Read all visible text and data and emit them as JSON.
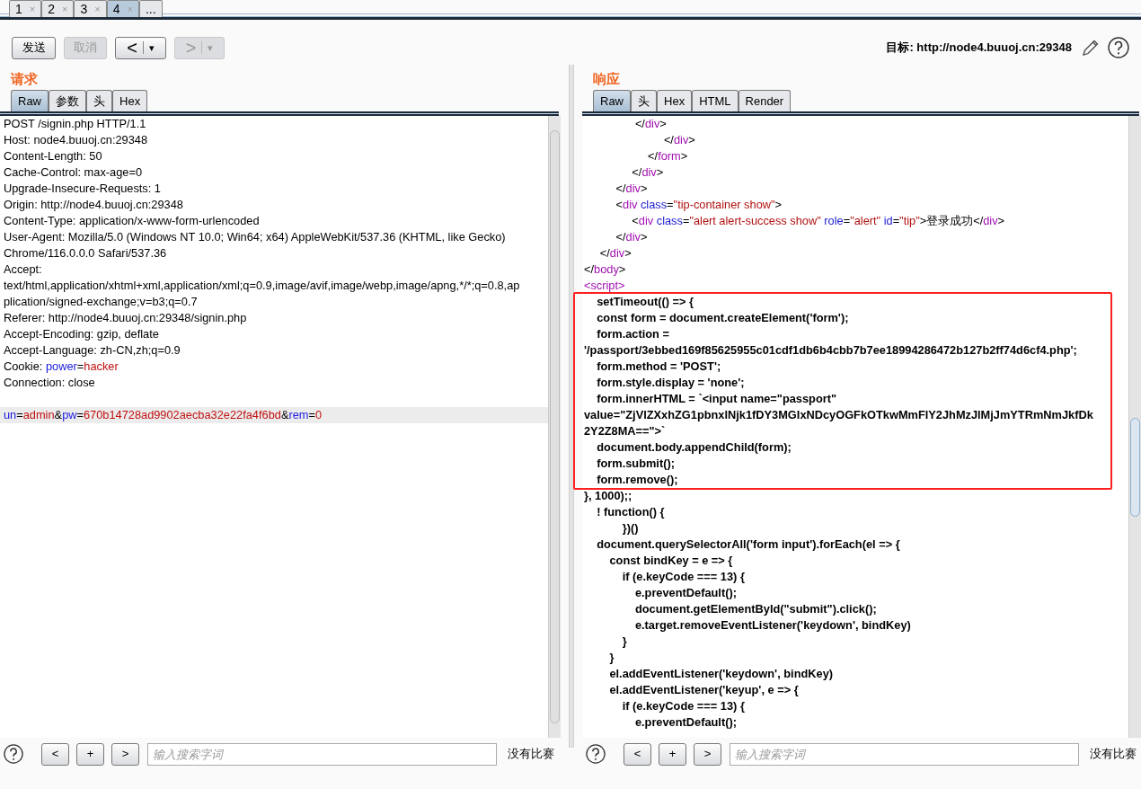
{
  "top_tabs": [
    {
      "label": "1",
      "close": "×",
      "selected": false
    },
    {
      "label": "2",
      "close": "×",
      "selected": false
    },
    {
      "label": "3",
      "close": "×",
      "selected": false
    },
    {
      "label": "4",
      "close": "×",
      "selected": true
    },
    {
      "label": "...",
      "selected": false
    }
  ],
  "toolbar": {
    "buttons": [
      {
        "label": "发送",
        "disabled": false
      },
      {
        "label": "取消",
        "disabled": true
      },
      {
        "label": "<",
        "caret": "▾",
        "disabled": false
      },
      {
        "label": ">",
        "caret": "▾",
        "disabled": true
      }
    ],
    "target": "目标: http://node4.buuoj.cn:29348"
  },
  "panes": [
    {
      "title": "请求",
      "tabs": [
        {
          "label": "Raw",
          "selected": true
        },
        {
          "label": "参数",
          "selected": false
        },
        {
          "label": "头",
          "selected": false
        },
        {
          "label": "Hex",
          "selected": false
        }
      ],
      "lines": [
        {
          "s": [
            {
              "text": "POST /signin.php HTTP/1.1",
              "kind": "text"
            }
          ],
          "highlighted": false
        },
        {
          "s": [
            {
              "text": "Host: node4.buuoj.cn:29348",
              "kind": "text"
            }
          ],
          "highlighted": false
        },
        {
          "s": [
            {
              "text": "Content-Length: 50",
              "kind": "text"
            }
          ],
          "highlighted": false
        },
        {
          "s": [
            {
              "text": "Cache-Control: max-age=0",
              "kind": "text"
            }
          ],
          "highlighted": false
        },
        {
          "s": [
            {
              "text": "Upgrade-Insecure-Requests: 1",
              "kind": "text"
            }
          ],
          "highlighted": false
        },
        {
          "s": [
            {
              "text": "Origin: http://node4.buuoj.cn:29348",
              "kind": "text"
            }
          ],
          "highlighted": false
        },
        {
          "s": [
            {
              "text": "Content-Type: application/x-www-form-urlencoded",
              "kind": "text"
            }
          ],
          "highlighted": false
        },
        {
          "s": [
            {
              "text": "User-Agent: Mozilla/5.0 (Windows NT 10.0; Win64; x64) AppleWebKit/537.36 (KHTML, like Gecko)",
              "kind": "text"
            }
          ],
          "highlighted": false
        },
        {
          "s": [
            {
              "text": "Chrome/116.0.0.0 Safari/537.36",
              "kind": "text"
            }
          ],
          "highlighted": false
        },
        {
          "s": [
            {
              "text": "Accept:",
              "kind": "text"
            }
          ],
          "highlighted": false
        },
        {
          "s": [
            {
              "text": "text/html,application/xhtml+xml,application/xml;q=0.9,image/avif,image/webp,image/apng,*/*;q=0.8,ap",
              "kind": "text"
            }
          ],
          "highlighted": false
        },
        {
          "s": [
            {
              "text": "plication/signed-exchange;v=b3;q=0.7",
              "kind": "text"
            }
          ],
          "highlighted": false
        },
        {
          "s": [
            {
              "text": "Referer: http://node4.buuoj.cn:29348/signin.php",
              "kind": "text"
            }
          ],
          "highlighted": false
        },
        {
          "s": [
            {
              "text": "Accept-Encoding: gzip, deflate",
              "kind": "text"
            }
          ],
          "highlighted": false
        },
        {
          "s": [
            {
              "text": "Accept-Language: zh-CN,zh;q=0.9",
              "kind": "text"
            }
          ],
          "highlighted": false
        },
        {
          "s": [
            {
              "text": "Cookie: ",
              "kind": "text"
            },
            {
              "text": "power",
              "kind": "param"
            },
            {
              "text": "=",
              "kind": "text"
            },
            {
              "text": "hacker",
              "kind": "param_value"
            }
          ],
          "highlighted": false
        },
        {
          "s": [
            {
              "text": "Connection: close",
              "kind": "text"
            }
          ],
          "highlighted": false
        },
        {
          "highlighted": false
        },
        {
          "s": [
            {
              "text": "un",
              "kind": "param"
            },
            {
              "text": "=",
              "kind": "text"
            },
            {
              "text": "admin",
              "kind": "param_value"
            },
            {
              "text": "&",
              "kind": "text"
            },
            {
              "text": "pw",
              "kind": "param"
            },
            {
              "text": "=",
              "kind": "text"
            },
            {
              "text": "670b14728ad9902aecba32e22fa4f6bd",
              "kind": "param_value"
            },
            {
              "text": "&",
              "kind": "text"
            },
            {
              "text": "rem",
              "kind": "param"
            },
            {
              "text": "=",
              "kind": "text"
            },
            {
              "text": "0",
              "kind": "param_value"
            }
          ],
          "highlighted": true
        }
      ],
      "search": {
        "buttons": [
          "<",
          "+",
          ">"
        ],
        "placeholder": "输入搜索字词",
        "matches": "没有比赛"
      }
    },
    {
      "title": "响应",
      "tabs": [
        {
          "label": "Raw",
          "selected": true
        },
        {
          "label": "头",
          "selected": false
        },
        {
          "label": "Hex",
          "selected": false
        },
        {
          "label": "HTML",
          "selected": false
        },
        {
          "label": "Render",
          "selected": false
        }
      ],
      "lines": [
        {
          "s": [
            {
              "text": "                </",
              "kind": "text"
            },
            {
              "text": "div",
              "kind": "tag"
            },
            {
              "text": ">",
              "kind": "text"
            }
          ],
          "boxed": false
        },
        {
          "s": [
            {
              "text": "                         </",
              "kind": "text"
            },
            {
              "text": "div",
              "kind": "tag"
            },
            {
              "text": ">",
              "kind": "text"
            }
          ],
          "boxed": false
        },
        {
          "s": [
            {
              "text": "                    </",
              "kind": "text"
            },
            {
              "text": "form",
              "kind": "tag"
            },
            {
              "text": ">",
              "kind": "text"
            }
          ],
          "boxed": false
        },
        {
          "s": [
            {
              "text": "               </",
              "kind": "text"
            },
            {
              "text": "div",
              "kind": "tag"
            },
            {
              "text": ">",
              "kind": "text"
            }
          ],
          "boxed": false
        },
        {
          "s": [
            {
              "text": "          </",
              "kind": "text"
            },
            {
              "text": "div",
              "kind": "tag"
            },
            {
              "text": ">",
              "kind": "text"
            }
          ],
          "boxed": false
        },
        {
          "s": [
            {
              "text": "          <",
              "kind": "text"
            },
            {
              "text": "div",
              "kind": "tag"
            },
            {
              "text": " class",
              "kind": "attr"
            },
            {
              "text": "=",
              "kind": "text"
            },
            {
              "text": "\"tip-container show\"",
              "kind": "value"
            },
            {
              "text": ">",
              "kind": "text"
            }
          ],
          "boxed": false
        },
        {
          "s": [
            {
              "text": "               <",
              "kind": "text"
            },
            {
              "text": "div",
              "kind": "tag"
            },
            {
              "text": " class",
              "kind": "attr"
            },
            {
              "text": "=",
              "kind": "text"
            },
            {
              "text": "\"alert alert-success show\"",
              "kind": "value"
            },
            {
              "text": " role",
              "kind": "attr"
            },
            {
              "text": "=",
              "kind": "text"
            },
            {
              "text": "\"alert\"",
              "kind": "value"
            },
            {
              "text": " id",
              "kind": "attr"
            },
            {
              "text": "=",
              "kind": "text"
            },
            {
              "text": "\"tip\"",
              "kind": "value"
            },
            {
              "text": ">登录成功</",
              "kind": "text"
            },
            {
              "text": "div",
              "kind": "tag"
            },
            {
              "text": ">",
              "kind": "text"
            }
          ],
          "boxed": false
        },
        {
          "s": [
            {
              "text": "          </",
              "kind": "text"
            },
            {
              "text": "div",
              "kind": "tag"
            },
            {
              "text": ">",
              "kind": "text"
            }
          ],
          "boxed": false
        },
        {
          "s": [
            {
              "text": "     </",
              "kind": "text"
            },
            {
              "text": "div",
              "kind": "tag"
            },
            {
              "text": ">",
              "kind": "text"
            }
          ],
          "boxed": false
        },
        {
          "s": [
            {
              "text": "</",
              "kind": "text"
            },
            {
              "text": "body",
              "kind": "tag"
            },
            {
              "text": ">",
              "kind": "text"
            }
          ],
          "boxed": false
        },
        {
          "s": [
            {
              "text": "<script>",
              "kind": "tag"
            }
          ],
          "boxed": false
        },
        {
          "s": [
            {
              "text": "    setTimeout(() => {",
              "kind": "script"
            }
          ],
          "boxed": true
        },
        {
          "s": [
            {
              "text": "    const form = document.createElement('form');",
              "kind": "script"
            }
          ],
          "boxed": true
        },
        {
          "s": [
            {
              "text": "    form.action =",
              "kind": "script"
            }
          ],
          "boxed": true
        },
        {
          "s": [
            {
              "text": "'/passport/3ebbed169f85625955c01cdf1db6b4cbb7b7ee18994286472b127b2ff74d6cf4.php';",
              "kind": "script"
            }
          ],
          "boxed": true
        },
        {
          "s": [
            {
              "text": "    form.method = 'POST';",
              "kind": "script"
            }
          ],
          "boxed": true
        },
        {
          "s": [
            {
              "text": "    form.style.display = 'none';",
              "kind": "script"
            }
          ],
          "boxed": true
        },
        {
          "s": [
            {
              "text": "    form.innerHTML = `<input name=\"passport\"",
              "kind": "script"
            }
          ],
          "boxed": true
        },
        {
          "s": [
            {
              "text": "value=\"ZjVlZXxhZG1pbnxlNjk1fDY3MGIxNDcyOGFkOTkwMmFlY2JhMzJlMjJmYTRmNmJkfDk",
              "kind": "script"
            }
          ],
          "boxed": true
        },
        {
          "s": [
            {
              "text": "2Y2Z8MA==\">`",
              "kind": "script"
            }
          ],
          "boxed": true
        },
        {
          "s": [
            {
              "text": "    document.body.appendChild(form);",
              "kind": "script"
            }
          ],
          "boxed": true
        },
        {
          "s": [
            {
              "text": "    form.submit();",
              "kind": "script"
            }
          ],
          "boxed": true
        },
        {
          "s": [
            {
              "text": "    form.remove();",
              "kind": "script"
            }
          ],
          "boxed": true
        },
        {
          "s": [
            {
              "text": "}, 1000);;",
              "kind": "script"
            }
          ],
          "boxed": false
        },
        {
          "s": [
            {
              "text": "    ! function() {",
              "kind": "script"
            }
          ],
          "boxed": false
        },
        {
          "s": [
            {
              "text": "            })()",
              "kind": "script"
            }
          ],
          "boxed": false
        },
        {
          "s": [
            {
              "text": "    document.querySelectorAll('form input').forEach(el => {",
              "kind": "script"
            }
          ],
          "boxed": false
        },
        {
          "s": [
            {
              "text": "        const bindKey = e => {",
              "kind": "script"
            }
          ],
          "boxed": false
        },
        {
          "s": [
            {
              "text": "            if (e.keyCode === 13) {",
              "kind": "script"
            }
          ],
          "boxed": false
        },
        {
          "s": [
            {
              "text": "                e.preventDefault();",
              "kind": "script"
            }
          ],
          "boxed": false
        },
        {
          "s": [
            {
              "text": "                document.getElementById(\"submit\").click();",
              "kind": "script"
            }
          ],
          "boxed": false
        },
        {
          "s": [
            {
              "text": "                e.target.removeEventListener('keydown', bindKey)",
              "kind": "script"
            }
          ],
          "boxed": false
        },
        {
          "s": [
            {
              "text": "            }",
              "kind": "script"
            }
          ],
          "boxed": false
        },
        {
          "s": [
            {
              "text": "        }",
              "kind": "script"
            }
          ],
          "boxed": false
        },
        {
          "s": [
            {
              "text": "        el.addEventListener('keydown', bindKey)",
              "kind": "script"
            }
          ],
          "boxed": false
        },
        {
          "s": [
            {
              "text": "        el.addEventListener('keyup', e => {",
              "kind": "script"
            }
          ],
          "boxed": false
        },
        {
          "s": [
            {
              "text": "            if (e.keyCode === 13) {",
              "kind": "script"
            }
          ],
          "boxed": false
        },
        {
          "s": [
            {
              "text": "                e.preventDefault();",
              "kind": "script"
            }
          ],
          "boxed": false
        }
      ],
      "search": {
        "buttons": [
          "<",
          "+",
          ">"
        ],
        "placeholder": "输入搜索字词",
        "matches": "没有比赛"
      }
    }
  ]
}
